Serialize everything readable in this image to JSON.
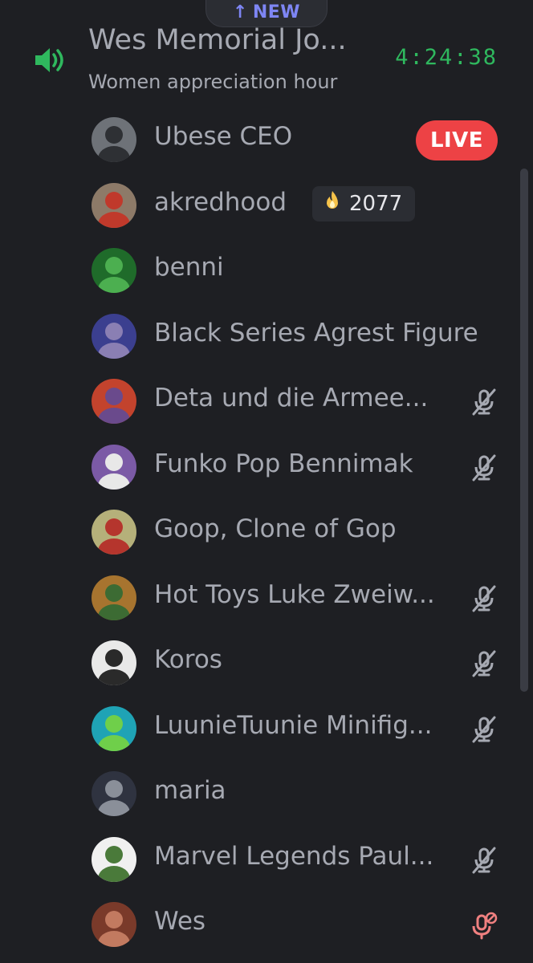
{
  "top_pill": {
    "arrow": "↑",
    "label": "NEW"
  },
  "channel": {
    "name": "Wes Memorial Jo...",
    "topic": "Women appreciation hour",
    "timer": "4:24:38",
    "speaker_icon": "speaker-icon",
    "accent_color": "#2fb85e"
  },
  "members": [
    {
      "name": "Ubese CEO",
      "badge": "LIVE",
      "avatar_colors": [
        "#6e7278",
        "#2e3034"
      ],
      "status": "live"
    },
    {
      "name": "akredhood",
      "boost": "2077",
      "avatar_colors": [
        "#8d7a68",
        "#c0392b"
      ],
      "status": "boost"
    },
    {
      "name": "benni",
      "avatar_colors": [
        "#1f6b2a",
        "#4caf50"
      ],
      "status": ""
    },
    {
      "name": "Black Series Agrest Figure",
      "avatar_colors": [
        "#3b3f8f",
        "#8a7fb3"
      ],
      "status": ""
    },
    {
      "name": "Deta und die Armee...",
      "avatar_colors": [
        "#c3432d",
        "#6a4a8c"
      ],
      "status": "muted"
    },
    {
      "name": "Funko Pop Bennimak",
      "avatar_colors": [
        "#7b5aa6",
        "#e8e8e8"
      ],
      "status": "muted"
    },
    {
      "name": "Goop, Clone of Gop",
      "avatar_colors": [
        "#b5b07a",
        "#b5352d"
      ],
      "status": ""
    },
    {
      "name": "Hot Toys Luke Zweiw...",
      "avatar_colors": [
        "#a7742f",
        "#3c6b33"
      ],
      "status": "muted"
    },
    {
      "name": "Koros",
      "avatar_colors": [
        "#e9e9e9",
        "#2a2a2a"
      ],
      "status": "muted"
    },
    {
      "name": "LuunieTuunie Minifig...",
      "avatar_colors": [
        "#1fa3b5",
        "#6fcf4a"
      ],
      "status": "muted"
    },
    {
      "name": "maria",
      "avatar_colors": [
        "#2f3340",
        "#8a8f99"
      ],
      "status": ""
    },
    {
      "name": "Marvel Legends Paul...",
      "avatar_colors": [
        "#f0f0f0",
        "#4a7a3a"
      ],
      "status": "muted"
    },
    {
      "name": "Wes",
      "avatar_colors": [
        "#7a3a2a",
        "#c27a60"
      ],
      "status": "speaking-muted"
    }
  ],
  "colors": {
    "background": "#1e1f23",
    "text_muted": "#a6a9b2",
    "live_red": "#ed4245",
    "mute_icon": "#a6a9b2",
    "wes_mic": "#f08080"
  }
}
